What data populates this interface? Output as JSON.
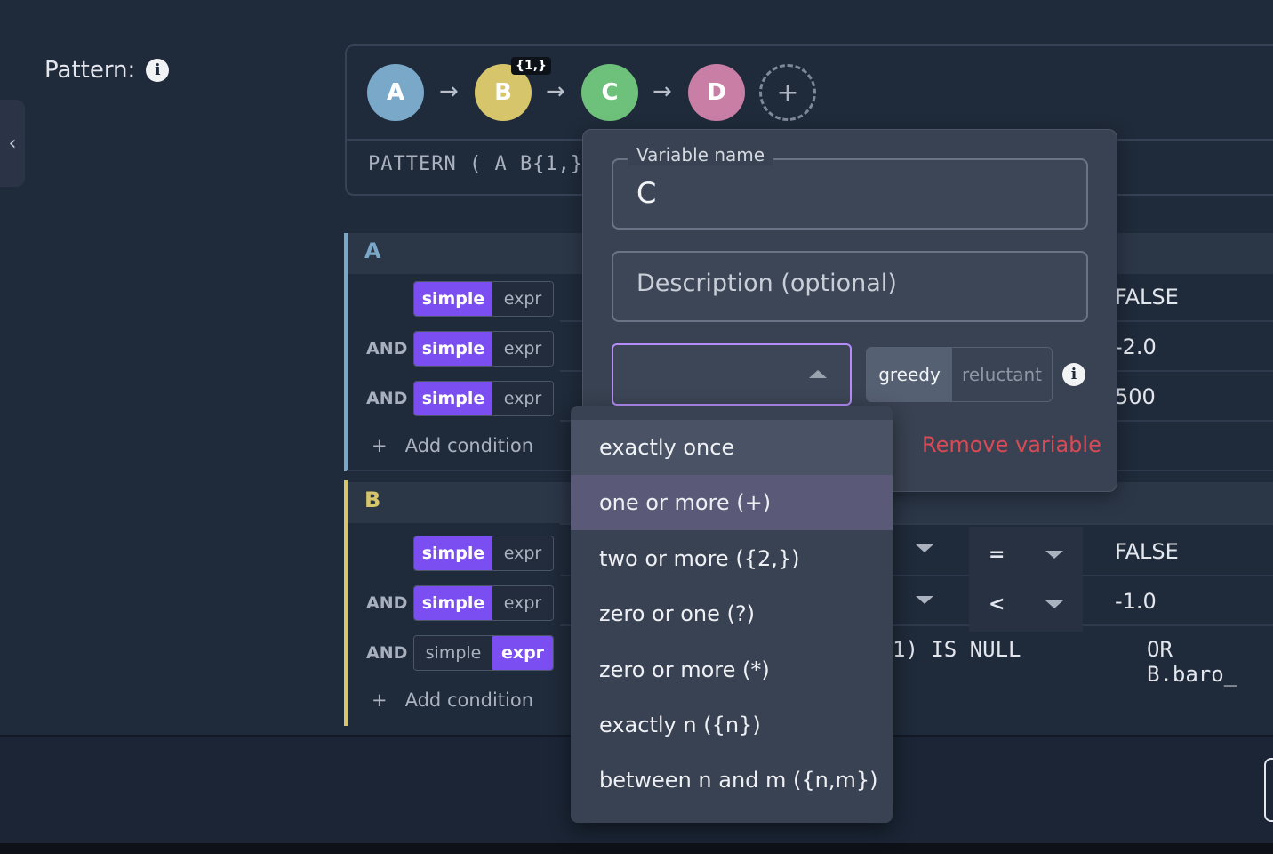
{
  "sidebar": {
    "collapse_icon": "chevron-left-icon",
    "collapse_glyph": "‹"
  },
  "pattern": {
    "label": "Pattern:",
    "info_glyph": "i",
    "nodes": [
      {
        "label": "A",
        "color": "#7aa8c8"
      },
      {
        "label": "B",
        "color": "#d6c56a",
        "quantifier": "{1,}"
      },
      {
        "label": "C",
        "color": "#6ec17a"
      },
      {
        "label": "D",
        "color": "#c97ea6"
      }
    ],
    "arrow_glyph": "→",
    "add_glyph": "+",
    "expression": "PATTERN ( A B{1,}"
  },
  "sections": {
    "a": {
      "letter": "A",
      "color": "#7aa8c8",
      "conditions": [
        {
          "and": "",
          "simple": "simple",
          "expr": "expr",
          "mode": "simple",
          "value": "FALSE"
        },
        {
          "and": "AND",
          "simple": "simple",
          "expr": "expr",
          "mode": "simple",
          "value": "-2.0"
        },
        {
          "and": "AND",
          "simple": "simple",
          "expr": "expr",
          "mode": "simple",
          "value": "500"
        }
      ],
      "add_condition": "Add condition"
    },
    "b": {
      "letter": "B",
      "color": "#d6c56a",
      "conditions": [
        {
          "and": "",
          "simple": "simple",
          "expr": "expr",
          "mode": "simple",
          "operator": "=",
          "value": "FALSE"
        },
        {
          "and": "AND",
          "simple": "simple",
          "expr": "expr",
          "mode": "simple",
          "operator": "<",
          "value": "-1.0"
        },
        {
          "and": "AND",
          "simple": "simple",
          "expr": "expr",
          "mode": "expr",
          "expression_a": "1) IS NULL",
          "expression_b": "OR B.baro_"
        }
      ],
      "add_condition": "Add condition"
    }
  },
  "popover": {
    "variable_name_label": "Variable name",
    "variable_name_value": "C",
    "description_placeholder": "Description (optional)",
    "quantifier_value": "",
    "mode_options": [
      "greedy",
      "reluctant"
    ],
    "mode_selected": "greedy",
    "remove_label": "Remove variable"
  },
  "dropdown": {
    "options": [
      "exactly once",
      "one or more (+)",
      "two or more ({2,})",
      "zero or one (?)",
      "zero or more (*)",
      "exactly n ({n})",
      "between n and m ({n,m})"
    ],
    "selected_index": 0,
    "hovered_index": 1
  },
  "colors": {
    "accent": "#7b4ef2",
    "danger": "#d84a55",
    "focus": "#b48cf5"
  }
}
